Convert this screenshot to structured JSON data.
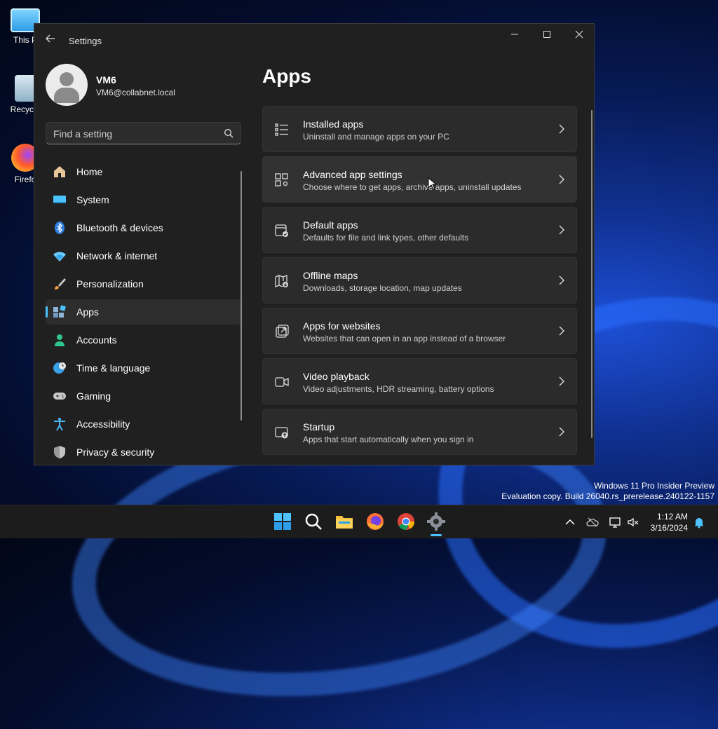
{
  "desktop": {
    "icons": [
      {
        "label": "This P"
      },
      {
        "label": "Recycle"
      },
      {
        "label": "Firefo"
      }
    ],
    "watermark": {
      "line1": "Windows 11 Pro Insider Preview",
      "line2": "Evaluation copy. Build 26040.rs_prerelease.240122-1157"
    }
  },
  "window": {
    "title": "Settings",
    "controls": {
      "minimize": "—",
      "maximize": "☐",
      "close": "✕"
    }
  },
  "user": {
    "name": "VM6",
    "email": "VM6@collabnet.local"
  },
  "search": {
    "placeholder": "Find a setting"
  },
  "nav": {
    "items": [
      {
        "label": "Home",
        "icon": "home-icon",
        "color": "#e8c69a"
      },
      {
        "label": "System",
        "icon": "system-icon",
        "color": "#4cc2ff"
      },
      {
        "label": "Bluetooth & devices",
        "icon": "bluetooth-icon",
        "color": "#2f7fe0"
      },
      {
        "label": "Network & internet",
        "icon": "wifi-icon",
        "color": "#6ad0ff"
      },
      {
        "label": "Personalization",
        "icon": "brush-icon",
        "color": "#f0a040"
      },
      {
        "label": "Apps",
        "icon": "apps-icon",
        "color": "#8fb3d8"
      },
      {
        "label": "Accounts",
        "icon": "accounts-icon",
        "color": "#2fc58f"
      },
      {
        "label": "Time & language",
        "icon": "globe-clock-icon",
        "color": "#3aa0e8"
      },
      {
        "label": "Gaming",
        "icon": "gamepad-icon",
        "color": "#c8c8c8"
      },
      {
        "label": "Accessibility",
        "icon": "accessibility-icon",
        "color": "#4ab4f0"
      },
      {
        "label": "Privacy & security",
        "icon": "shield-icon",
        "color": "#9a9a9a"
      }
    ],
    "active_index": 5
  },
  "main": {
    "title": "Apps",
    "cards": [
      {
        "title": "Installed apps",
        "subtitle": "Uninstall and manage apps on your PC",
        "icon": "list-icon"
      },
      {
        "title": "Advanced app settings",
        "subtitle": "Choose where to get apps, archive apps, uninstall updates",
        "icon": "app-settings-icon"
      },
      {
        "title": "Default apps",
        "subtitle": "Defaults for file and link types, other defaults",
        "icon": "default-apps-icon"
      },
      {
        "title": "Offline maps",
        "subtitle": "Downloads, storage location, map updates",
        "icon": "map-icon"
      },
      {
        "title": "Apps for websites",
        "subtitle": "Websites that can open in an app instead of a browser",
        "icon": "open-external-icon"
      },
      {
        "title": "Video playback",
        "subtitle": "Video adjustments, HDR streaming, battery options",
        "icon": "video-icon"
      },
      {
        "title": "Startup",
        "subtitle": "Apps that start automatically when you sign in",
        "icon": "startup-icon"
      }
    ]
  },
  "taskbar": {
    "apps": [
      {
        "name": "start",
        "icon": "windows-logo-icon"
      },
      {
        "name": "search",
        "icon": "search-icon"
      },
      {
        "name": "file-explorer",
        "icon": "folder-icon"
      },
      {
        "name": "firefox",
        "icon": "firefox-icon"
      },
      {
        "name": "chrome",
        "icon": "chrome-icon"
      },
      {
        "name": "settings",
        "icon": "gear-icon"
      }
    ],
    "clock": {
      "time": "1:12 AM",
      "date": "3/16/2024"
    }
  },
  "colors": {
    "accent": "#4cc2ff",
    "window_bg": "#202020",
    "card_bg": "#2b2b2b"
  }
}
